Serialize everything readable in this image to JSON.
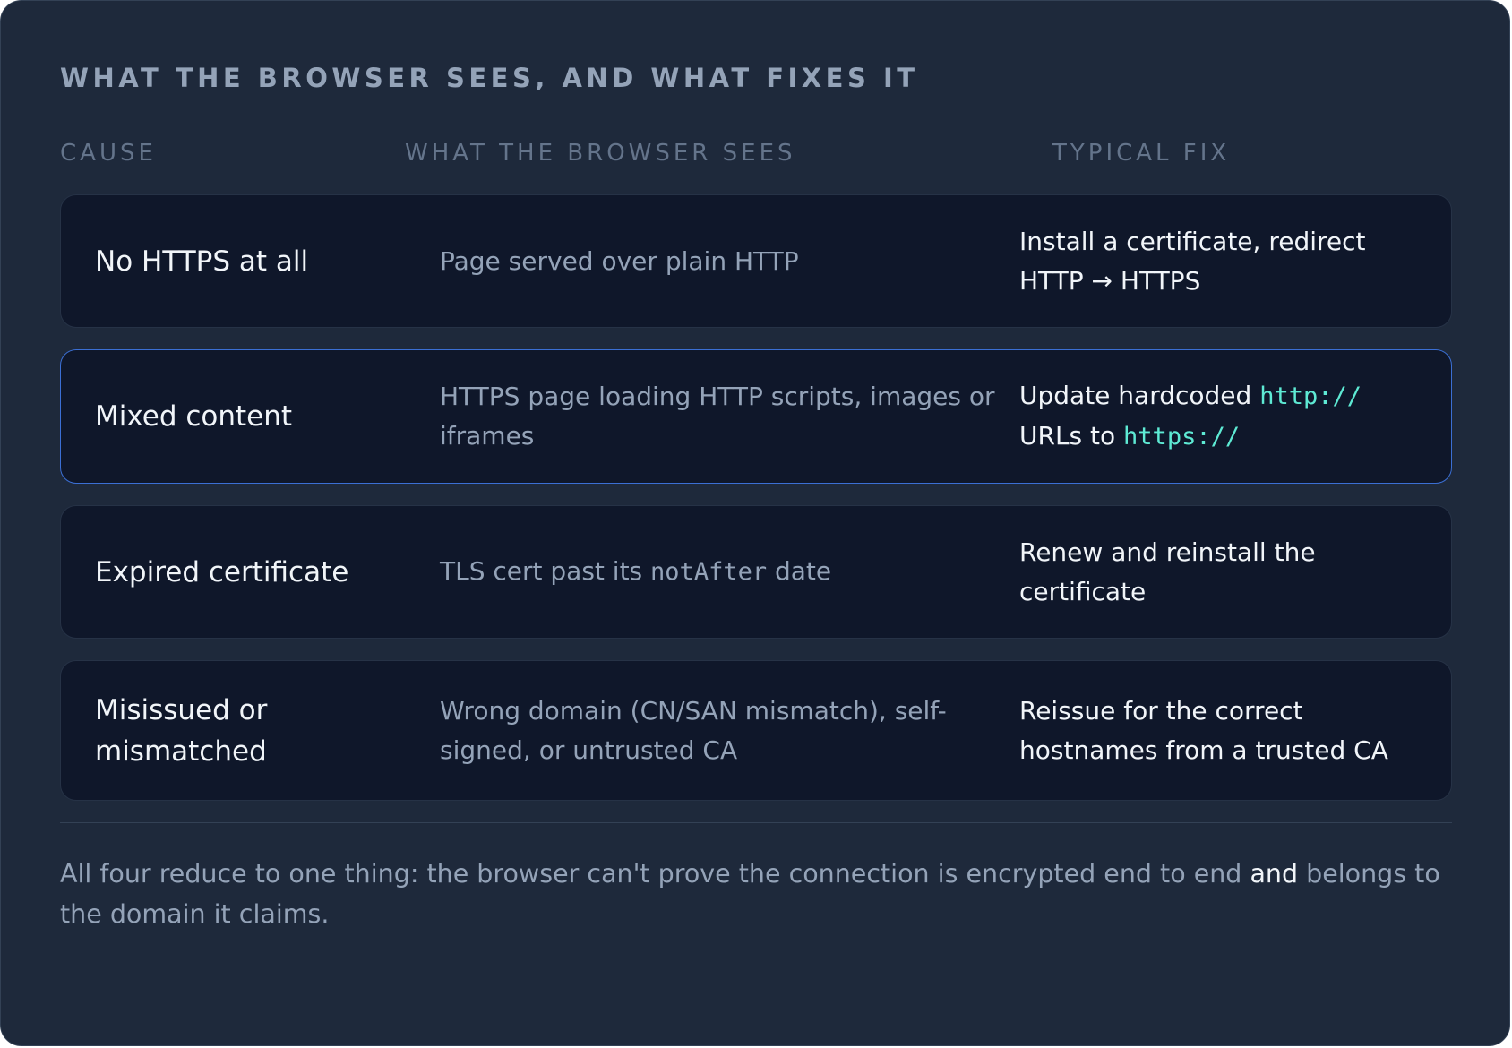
{
  "title": "WHAT THE BROWSER SEES, AND WHAT FIXES IT",
  "columns": {
    "cause": "CAUSE",
    "sees": "WHAT THE BROWSER SEES",
    "fix": "TYPICAL FIX"
  },
  "rows": [
    {
      "cause": "No HTTPS at all",
      "sees": {
        "text": "Page served over plain HTTP"
      },
      "fix": {
        "line1": "Install a certificate, redirect",
        "line2": "HTTP → HTTPS"
      }
    },
    {
      "cause": "Mixed content",
      "sees": {
        "text": "HTTPS page loading HTTP scripts, images or iframes"
      },
      "fix": {
        "pre1": "Update hardcoded ",
        "code1": "http://",
        "pre2": "URLs to ",
        "code2": "https://"
      }
    },
    {
      "cause": "Expired certificate",
      "sees": {
        "pre": "TLS cert past its ",
        "code": "notAfter",
        "post": " date"
      },
      "fix": {
        "text": "Renew and reinstall the certificate"
      }
    },
    {
      "cause": "Misissued or mismatched",
      "sees": {
        "text": "Wrong domain (CN/SAN mismatch), self-signed, or untrusted CA"
      },
      "fix": {
        "text": "Reissue for the correct hostnames from a trusted CA"
      }
    }
  ],
  "summary": {
    "pre": "All four reduce to one thing: the browser can't prove the connection is encrypted end to end ",
    "emphasis": "and",
    "post": " belongs to the domain it claims."
  },
  "colors": {
    "background": "#1e293b",
    "row_background": "#0f172a",
    "highlight_border": "#3b6fd4",
    "code": "#5eead4"
  }
}
